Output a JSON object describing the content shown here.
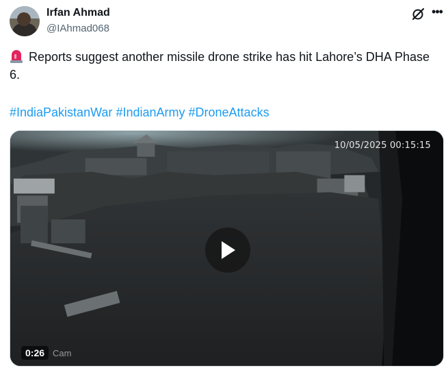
{
  "author": {
    "name": "Irfan Ahmad",
    "handle": "@IAhmad068"
  },
  "header": {
    "grok_icon": "grok-icon",
    "more_icon": "more-icon"
  },
  "post": {
    "emoji": "rotating-light-emoji",
    "text": "Reports suggest another missile drone strike has hit Lahore’s DHA Phase 6.",
    "hashtags": [
      "#IndiaPakistanWar",
      "#IndianArmy",
      "#DroneAttacks"
    ]
  },
  "video": {
    "timestamp_overlay": "10/05/2025 00:15:15",
    "duration": "0:26",
    "watermark": "Cam",
    "play_icon": "play-icon"
  },
  "colors": {
    "link": "#1d9bf0",
    "text": "#0f1419",
    "secondary": "#536471"
  }
}
